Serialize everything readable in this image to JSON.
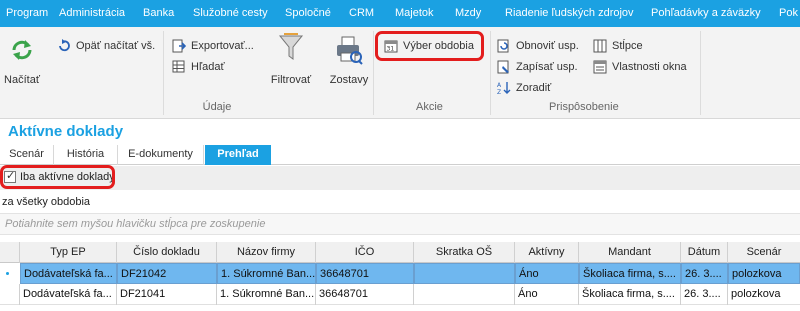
{
  "menu": [
    "Program",
    "Administrácia",
    "Banka",
    "Služobné cesty",
    "Spoločné",
    "CRM",
    "Majetok",
    "Mzdy",
    "Riadenie ľudských zdrojov",
    "Pohľadávky a záväzky",
    "Pok"
  ],
  "ribbon": {
    "refresh_label": "Načítať",
    "reload_all_label": "Opäť načítať vš.",
    "export_label": "Exportovať...",
    "search_label": "Hľadať",
    "filter_label": "Filtrovať",
    "reports_label": "Zostavy",
    "group_data": "Údaje",
    "period_select_label": "Výber obdobia",
    "group_actions": "Akcie",
    "restore_label": "Obnoviť usp.",
    "save_label": "Zapísať usp.",
    "sort_label": "Zoradiť",
    "columns_label": "Stĺpce",
    "window_props_label": "Vlastnosti okna",
    "group_customize": "Prispôsobenie"
  },
  "section_title": "Aktívne doklady",
  "tabs": [
    "Scenár",
    "História",
    "E-dokumenty",
    "Prehľad"
  ],
  "active_only_label": "Iba aktívne doklady",
  "period_text": "za všetky obdobia",
  "group_hint": "Potiahnite sem myšou hlavičku stĺpca pre zoskupenie",
  "grid": {
    "columns": [
      "Typ EP",
      "Číslo dokladu",
      "Názov firmy",
      "IČO",
      "Skratka OŠ",
      "Aktívny",
      "Mandant",
      "Dátum",
      "Scenár"
    ],
    "rows": [
      [
        "Dodávateľská fa...",
        "DF21042",
        "1. Súkromné Ban...",
        "36648701",
        "",
        "Áno",
        "Školiaca firma, s....",
        "26. 3....",
        "polozkova"
      ],
      [
        "Dodávateľská fa...",
        "DF21041",
        "1. Súkromné Ban...",
        "36648701",
        "",
        "Áno",
        "Školiaca firma, s....",
        "26. 3....",
        "polozkova"
      ]
    ]
  },
  "colors": {
    "accent": "#1ba1e2",
    "highlight_red": "#e31d1d",
    "selected_row": "#6fb7ef"
  }
}
